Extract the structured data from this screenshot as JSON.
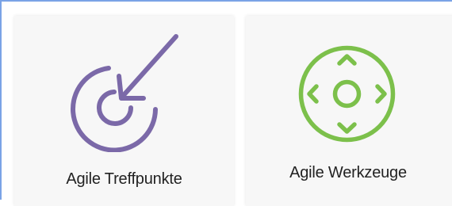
{
  "cards": [
    {
      "label": "Agile Treffpunkte",
      "icon": "target-arrow-icon",
      "icon_color": "#7b69a8"
    },
    {
      "label": "Agile Werkzeuge",
      "icon": "directional-pad-icon",
      "icon_color": "#7cc04b"
    }
  ],
  "colors": {
    "frame_border": "#7aa3e6",
    "card_background": "#f7f7f7",
    "text": "#222222"
  }
}
